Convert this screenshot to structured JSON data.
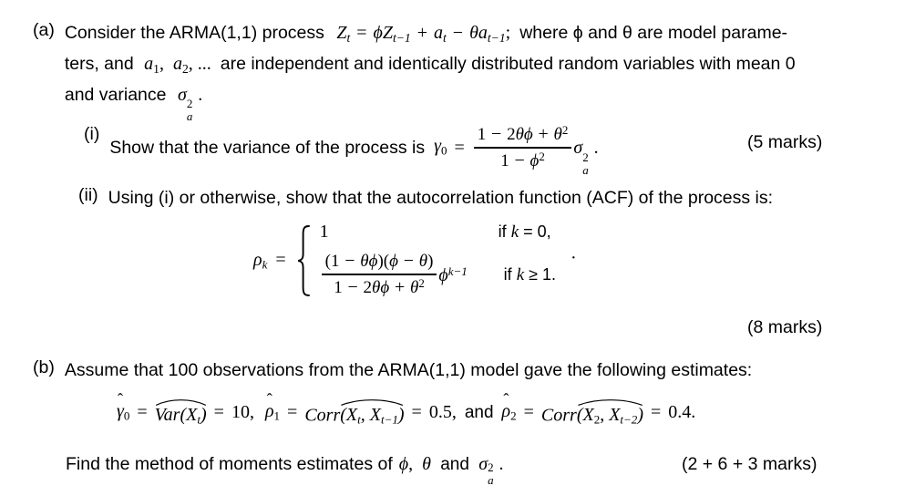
{
  "document": {
    "background": "#ffffff",
    "text_color": "#000000",
    "type": "exam-question"
  },
  "part_a": {
    "label": "(a)",
    "intro_line1_pre": "Consider the ARMA(1,1) process",
    "equation": "Z_t = ϕZ_{t-1} + a_t − θa_{t-1};",
    "intro_line1_post": "where ϕ and θ are model parame-",
    "intro_line2_pre": "ters, and",
    "intro_line2_vars": "a₁, a₂, ...",
    "intro_line2_post": "are independent and identically distributed random variables with mean 0",
    "intro_line3_pre": "and variance",
    "intro_line3_var": "σ²ₐ.",
    "symbols": {
      "Z": "Z",
      "phi": "ϕ",
      "theta": "θ",
      "a": "a",
      "sigma": "σ",
      "t": "t",
      "t_minus_1": "t−1"
    }
  },
  "item_i": {
    "label": "(i)",
    "text": "Show that the variance of the process is",
    "gamma": "γ",
    "gamma_sub": "0",
    "equals": "=",
    "numerator": "1 − 2θϕ + θ²",
    "denominator": "1 − ϕ²",
    "multiplier": "σ²ₐ.",
    "marks": "(5 marks)"
  },
  "item_ii": {
    "label": "(ii)",
    "text": "Using (i) or otherwise, show that the autocorrelation function (ACF) of the process is:",
    "rho": "ρ",
    "rho_sub": "k",
    "equals": "=",
    "case1_value": "1",
    "case1_condition": "if k = 0,",
    "case2_numerator": "(1 − θϕ)(ϕ − θ)",
    "case2_denominator": "1 − 2θϕ + θ²",
    "case2_factor": "ϕᵏ⁻¹",
    "case2_condition": "if k ≥ 1.",
    "trailing_dot": "·",
    "marks": "(8 marks)"
  },
  "part_b": {
    "label": "(b)",
    "text": "Assume that 100 observations from the ARMA(1,1) model gave the following estimates:",
    "estimates_line": {
      "gamma_hat": "γ̂",
      "gamma_sub": "0",
      "var_label": "Var",
      "var_arg": "(Xₜ)",
      "var_value": "10,",
      "rho1_hat": "ρ̂",
      "rho1_sub": "1",
      "corr1_label": "Corr",
      "corr1_arg": "(Xₜ, Xₜ₋₁)",
      "rho1_value": "0.5,",
      "and": "and",
      "rho2_hat": "ρ̂",
      "rho2_sub": "2",
      "corr2_label": "Corr",
      "corr2_arg": "(X₂, Xₜ₋₂)",
      "rho2_value": "0.4."
    },
    "final_text_pre": "Find the method of moments estimates of",
    "final_symbols": "ϕ, θ and σ²ₐ.",
    "marks": "(2 + 6 + 3 marks)"
  }
}
